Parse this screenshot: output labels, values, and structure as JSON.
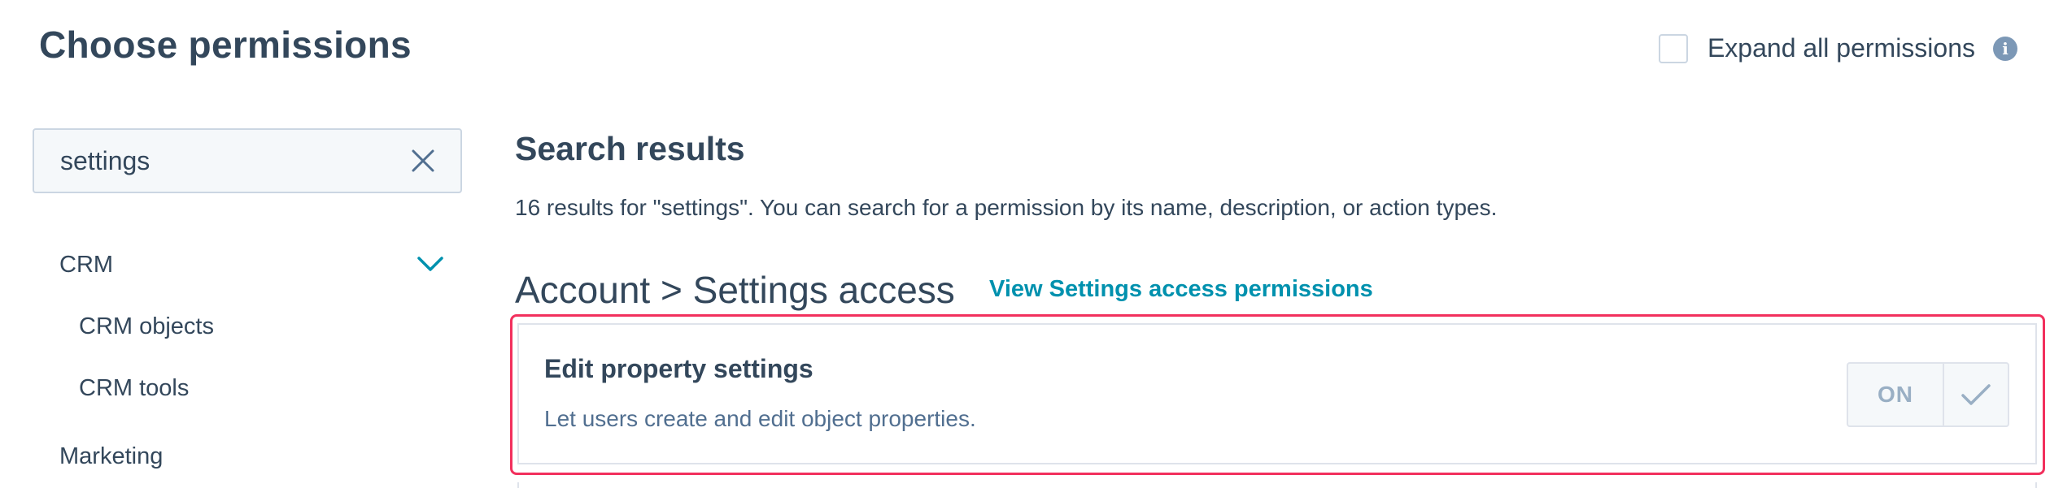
{
  "header": {
    "title": "Choose permissions",
    "expand_all_label": "Expand all permissions",
    "expand_all_checked": false,
    "info_icon": "info-icon"
  },
  "search": {
    "value": "settings",
    "clear_icon": "close-icon"
  },
  "sidebar": {
    "items": [
      {
        "label": "CRM",
        "expanded": true,
        "icon": "chevron-down-icon"
      },
      {
        "label": "CRM objects"
      },
      {
        "label": "CRM tools"
      },
      {
        "label": "Marketing"
      }
    ]
  },
  "results": {
    "heading": "Search results",
    "summary": "16 results for \"settings\". You can search for a permission by its name, description, or action types."
  },
  "section": {
    "title": "Account > Settings access",
    "link_label": "View Settings access permissions"
  },
  "permission": {
    "title": "Edit property settings",
    "description": "Let users create and edit object properties.",
    "toggle_label": "ON",
    "toggle_state": "on",
    "check_icon": "checkmark-icon"
  },
  "colors": {
    "text": "#33475b",
    "link": "#0091ae",
    "highlight": "#f2305d",
    "border": "#cbd6e2"
  }
}
